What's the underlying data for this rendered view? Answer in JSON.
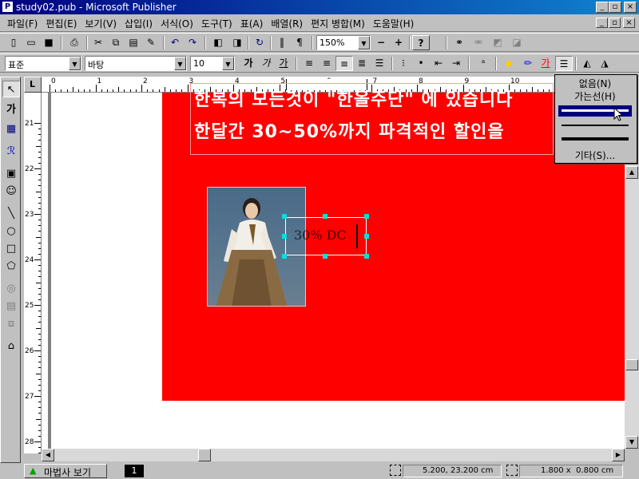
{
  "window": {
    "title": "study02.pub - Microsoft Publisher",
    "minimize": "_",
    "restore": "▫",
    "close": "×"
  },
  "menu": {
    "items": [
      "파일(F)",
      "편집(E)",
      "보기(V)",
      "삽입(I)",
      "서식(O)",
      "도구(T)",
      "표(A)",
      "배열(R)",
      "편지 병합(M)",
      "도움말(H)"
    ],
    "doc_controls": [
      "_",
      "▫",
      "×"
    ]
  },
  "toolbar": {
    "zoom": "150%",
    "zoom_minus": "−",
    "zoom_plus": "+"
  },
  "format_toolbar": {
    "style": "표준",
    "font": "바탕",
    "size": "10",
    "bold": "가",
    "italic": "가",
    "underline": "가"
  },
  "ruler": {
    "corner": "L",
    "h_ticks": [
      "0",
      "1",
      "2",
      "3",
      "4",
      "5",
      "6",
      "7",
      "8",
      "9",
      "10"
    ],
    "v_ticks": [
      "21",
      "22",
      "23",
      "24",
      "25",
      "26",
      "27",
      "28"
    ]
  },
  "document": {
    "headline1": "한복의 모든것이 \"한올주단\" 에 있습니다",
    "headline2": "한달간 30~50%까지 파격적인 할인을",
    "textbox": "30% DC"
  },
  "line_menu": {
    "none": "없음(N)",
    "hairline": "가는선(H)",
    "more": "기타(S)..."
  },
  "status": {
    "wizard": "마법사 보기",
    "page": "1",
    "position": "5.200, 23.200 cm",
    "size": "1.800 x  0.800 cm"
  },
  "colors": {
    "titlebar": "#000080",
    "page_fill": "#ff0000",
    "selection": "#000080",
    "handle": "#00e0e0"
  }
}
